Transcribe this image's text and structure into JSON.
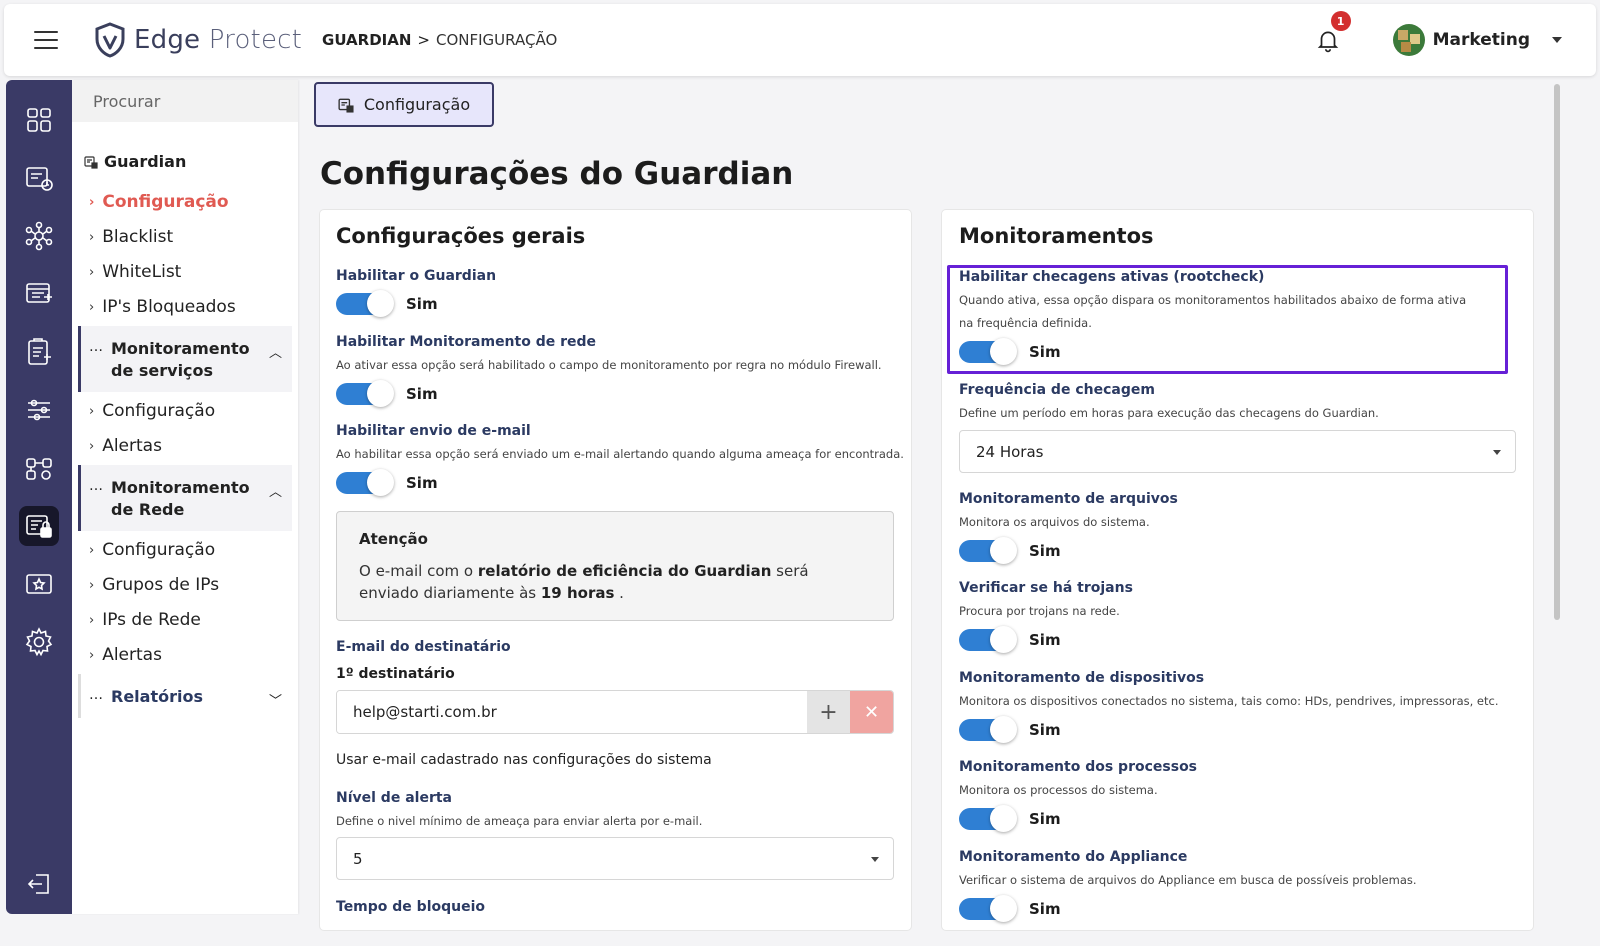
{
  "header": {
    "logo_text_1": "Edge",
    "logo_text_2": "Protect",
    "breadcrumb_1": "GUARDIAN",
    "breadcrumb_sep": ">",
    "breadcrumb_2": "CONFIGURAÇÃO",
    "notification_count": "1",
    "user_name": "Marketing"
  },
  "rail": {
    "icons": [
      "dashboard-icon",
      "reports-icon",
      "network-icon",
      "firewall-icon",
      "clipboard-icon",
      "sliders-icon",
      "services-icon",
      "guardian-icon",
      "vpn-icon",
      "settings-icon",
      "logout-icon"
    ],
    "active": "guardian-icon"
  },
  "subnav": {
    "search_placeholder": "Procurar",
    "group_title": "Guardian",
    "items_guardian": [
      "Configuração",
      "Blacklist",
      "WhiteList",
      "IP's Bloqueados"
    ],
    "section_services": "Monitoramento de serviços",
    "items_services": [
      "Configuração",
      "Alertas"
    ],
    "section_network": "Monitoramento de Rede",
    "items_network": [
      "Configuração",
      "Grupos de IPs",
      "IPs de Rede",
      "Alertas"
    ],
    "section_reports": "Relatórios"
  },
  "main": {
    "tab_label": "Configuração",
    "title": "Configurações do Guardian"
  },
  "left_card": {
    "title": "Configurações gerais",
    "enable_guardian_label": "Habilitar o Guardian",
    "enable_guardian_value": "Sim",
    "network_label": "Habilitar Monitoramento de rede",
    "network_desc": "Ao ativar essa opção será habilitado o campo de monitoramento por regra no módulo Firewall.",
    "network_value": "Sim",
    "email_label": "Habilitar envio de e-mail",
    "email_desc": "Ao habilitar essa opção será enviado um e-mail alertando quando alguma ameaça for encontrada.",
    "email_value": "Sim",
    "attention_title": "Atenção",
    "attention_pre": "O e-mail com o ",
    "attention_bold1": "relatório de eficiência do Guardian",
    "attention_mid": " será enviado diariamente às ",
    "attention_bold2": "19 horas",
    "attention_post": " .",
    "recipient_label": "E-mail do destinatário",
    "recipient_1_label": "1º destinatário",
    "recipient_1_value": "help@starti.com.br",
    "add_symbol": "+",
    "remove_symbol": "✕",
    "use_system_email": "Usar e-mail cadastrado nas configurações do sistema",
    "alert_level_label": "Nível de alerta",
    "alert_level_desc": "Define o nivel mínimo de ameaça para enviar alerta por e-mail.",
    "alert_level_value": "5",
    "block_time_label": "Tempo de bloqueio"
  },
  "right_card": {
    "title": "Monitoramentos",
    "rootcheck_label": "Habilitar checagens ativas (rootcheck)",
    "rootcheck_desc": "Quando ativa, essa opção dispara os monitoramentos habilitados abaixo de forma ativa na frequência definida.",
    "rootcheck_value": "Sim",
    "frequency_label": "Frequência de checagem",
    "frequency_desc": "Define um período em horas para execução das checagens do Guardian.",
    "frequency_value": "24 Horas",
    "files_label": "Monitoramento de arquivos",
    "files_desc": "Monitora os arquivos do sistema.",
    "files_value": "Sim",
    "trojans_label": "Verificar se há trojans",
    "trojans_desc": "Procura por trojans na rede.",
    "trojans_value": "Sim",
    "devices_label": "Monitoramento de dispositivos",
    "devices_desc": "Monitora os dispositivos conectados no sistema, tais como: HDs, pendrives, impressoras, etc.",
    "devices_value": "Sim",
    "processes_label": "Monitoramento dos processos",
    "processes_desc": "Monitora os processos do sistema.",
    "processes_value": "Sim",
    "appliance_label": "Monitoramento do Appliance",
    "appliance_desc": "Verificar o sistema de arquivos do Appliance em busca de possíveis problemas.",
    "appliance_value": "Sim"
  },
  "colors": {
    "accent_toggle": "#2f7fd3",
    "rail_bg": "#3a3a66",
    "active_nav": "#e05a52",
    "highlight_border": "#6620d6",
    "label_blue": "#2b3a62"
  }
}
